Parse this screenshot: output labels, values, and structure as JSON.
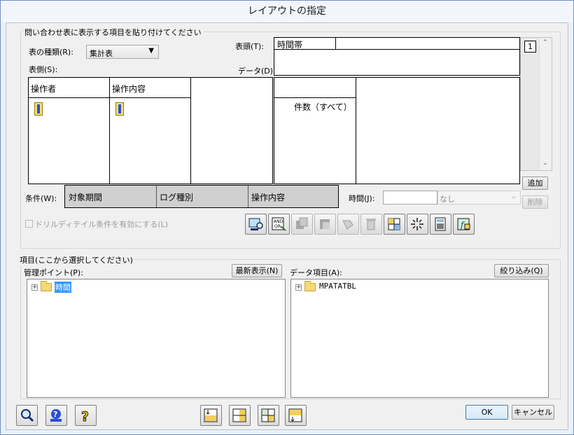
{
  "window": {
    "title": "レイアウトの指定"
  },
  "query_group": {
    "title": "問い合わせ表に表示する項目を貼り付けてください",
    "table_type_label": "表の種類(R):",
    "table_type_value": "集計表",
    "row_side_label": "表側(S):",
    "header_label": "表頭(T):",
    "header_value": "時間帯",
    "data_label": "データ(D):",
    "page_number": "1",
    "row_columns": [
      "操作者",
      "操作内容"
    ],
    "data_item": "件数（すべて）",
    "add_button": "追加",
    "delete_button": "削除",
    "condition_label": "条件(W):",
    "conditions": [
      "対象期間",
      "ログ種別",
      "操作内容"
    ],
    "time_label": "時間(J):",
    "time_unit": "なし",
    "drill_checkbox": "ドリルディテイル条件を有効にする(L)"
  },
  "items_group": {
    "title": "項目(ここから選択してください)",
    "mgmt_label": "管理ポイント(P):",
    "refresh_button": "最新表示(N)",
    "mgmt_tree": [
      "時間"
    ],
    "data_label": "データ項目(A):",
    "filter_button": "絞り込み(Q)",
    "data_tree": [
      "MPATATBL"
    ]
  },
  "footer": {
    "ok": "OK",
    "cancel": "キャンセル"
  }
}
